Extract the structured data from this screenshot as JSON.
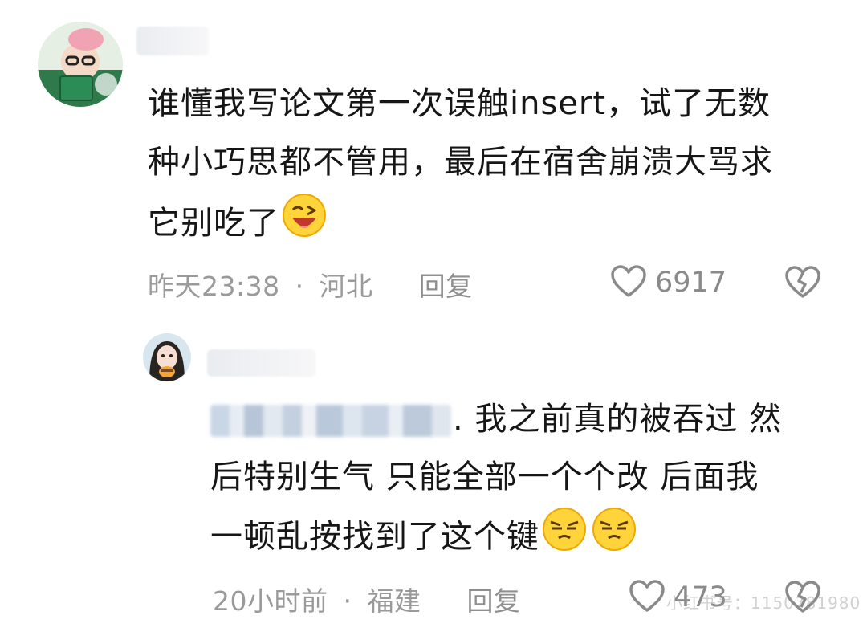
{
  "comments": [
    {
      "text_line1": "谁懂我写论文第一次误触insert，试了无数",
      "text_line2": "种小巧思都不管用，最后在宿舍崩溃大骂求",
      "text_line3": "它别吃了",
      "emoji": "laughing-wink-emoji",
      "time": "昨天23:38",
      "separator": "·",
      "location": "河北",
      "reply_label": "回复",
      "likes": "6917",
      "icons": {
        "like": "heart-outline-icon",
        "dislike": "broken-heart-icon"
      }
    },
    {
      "text_line1_suffix": ". 我之前真的被吞过 然",
      "text_line2": "后特别生气 只能全部一个个改 后面我",
      "text_line3": "一顿乱按找到了这个键",
      "emoji": "smug-squint-emoji",
      "time": "20小时前",
      "separator": "·",
      "location": "福建",
      "reply_label": "回复",
      "likes": "473",
      "icons": {
        "like": "heart-outline-icon",
        "dislike": "broken-heart-icon"
      }
    }
  ],
  "watermark": "小红书号：1150781980",
  "colors": {
    "meta": "#9a9a9a",
    "text": "#161616",
    "emoji_yellow": "#ffd43b"
  }
}
